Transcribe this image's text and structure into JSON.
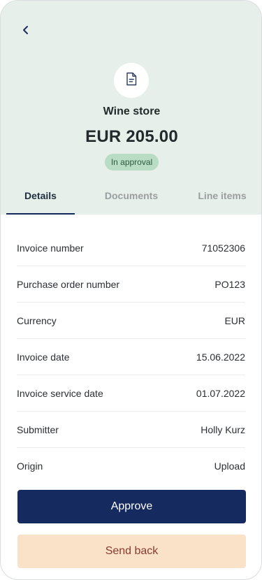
{
  "header": {
    "back_icon": "chevron-left-icon",
    "avatar_icon": "document-icon",
    "vendor": "Wine store",
    "amount": "EUR 205.00",
    "status": "In approval"
  },
  "tabs": [
    {
      "label": "Details",
      "active": true
    },
    {
      "label": "Documents",
      "active": false
    },
    {
      "label": "Line items",
      "active": false
    }
  ],
  "details": [
    {
      "label": "Invoice number",
      "value": "71052306"
    },
    {
      "label": "Purchase order number",
      "value": "PO123"
    },
    {
      "label": "Currency",
      "value": "EUR"
    },
    {
      "label": "Invoice date",
      "value": "15.06.2022"
    },
    {
      "label": "Invoice service date",
      "value": "01.07.2022"
    },
    {
      "label": "Submitter",
      "value": "Holly Kurz"
    },
    {
      "label": "Origin",
      "value": "Upload"
    }
  ],
  "actions": {
    "approve": "Approve",
    "send_back": "Send back"
  },
  "colors": {
    "header_bg": "#e6efea",
    "primary": "#152a5e",
    "badge_bg": "#b9dcc4",
    "secondary_bg": "#f9e2c7",
    "secondary_text": "#8a3b2f"
  }
}
